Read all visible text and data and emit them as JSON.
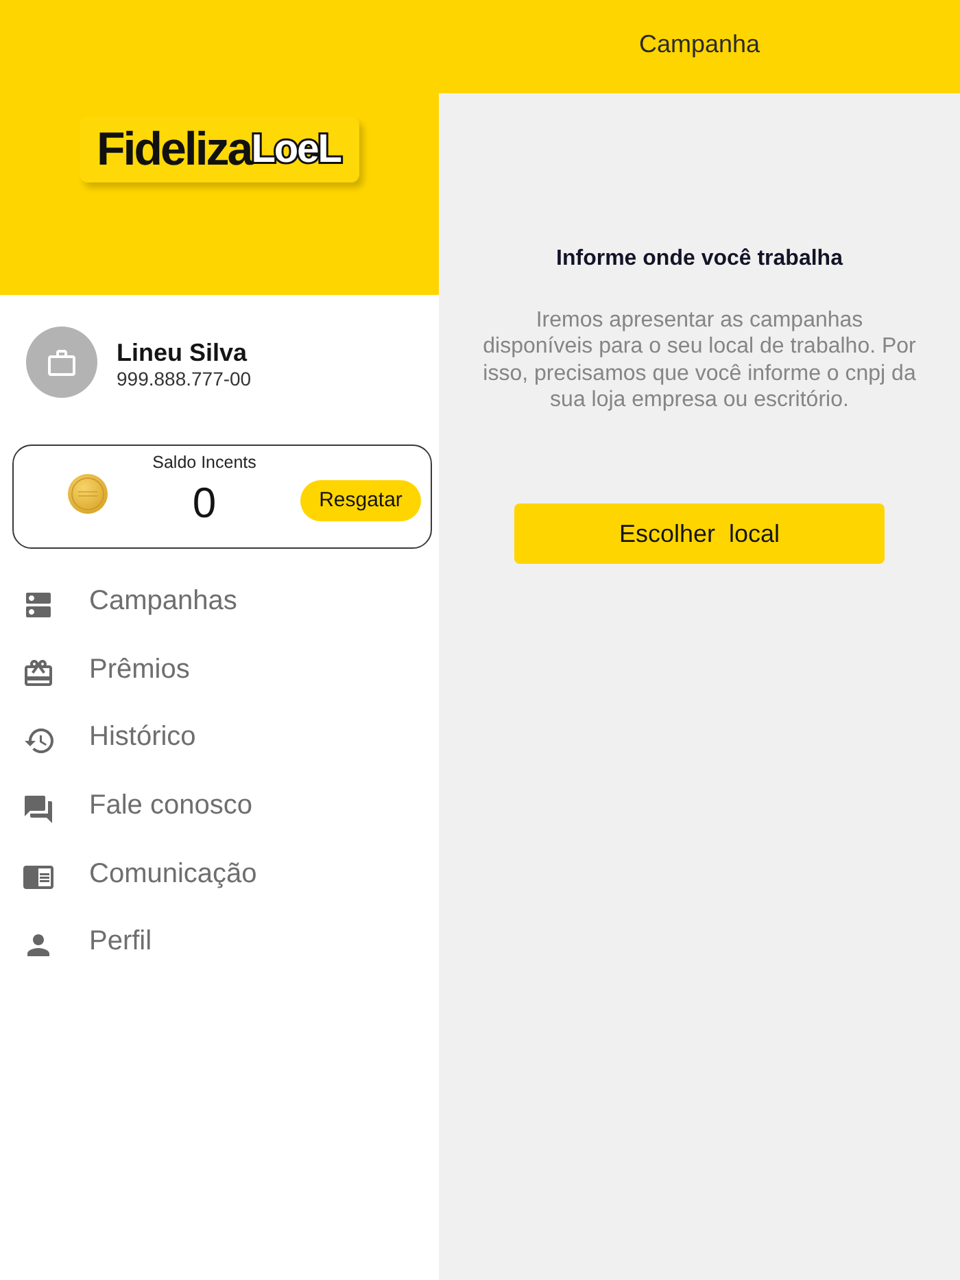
{
  "drawer": {
    "logo": {
      "text": "Fideliza",
      "accent": "LoeL"
    },
    "profile": {
      "name": "Lineu Silva",
      "document": "999.888.777-00"
    },
    "balance": {
      "label": "Saldo Incents",
      "value": "0",
      "button": "Resgatar"
    },
    "menu": [
      {
        "kind": "campaigns",
        "label": "Campanhas",
        "selected": false
      },
      {
        "kind": "prizes",
        "label": "Prêmios",
        "selected": false
      },
      {
        "kind": "history",
        "label": "Histórico",
        "selected": false
      },
      {
        "kind": "contact",
        "label": "Fale conosco",
        "selected": false
      },
      {
        "kind": "news",
        "label": "Comunicação",
        "selected": false
      },
      {
        "kind": "profile",
        "label": "Perfil",
        "selected": false
      }
    ]
  },
  "app_bar": {
    "title": "Campanha"
  },
  "content": {
    "heading": "Informe onde você trabalha",
    "text": "Iremos apresentar as campanhas disponíveis para o seu local de trabalho. Por isso, precisamos que você informe o cnpj da sua loja empresa ou escritório.",
    "button": "Escolher  local"
  }
}
